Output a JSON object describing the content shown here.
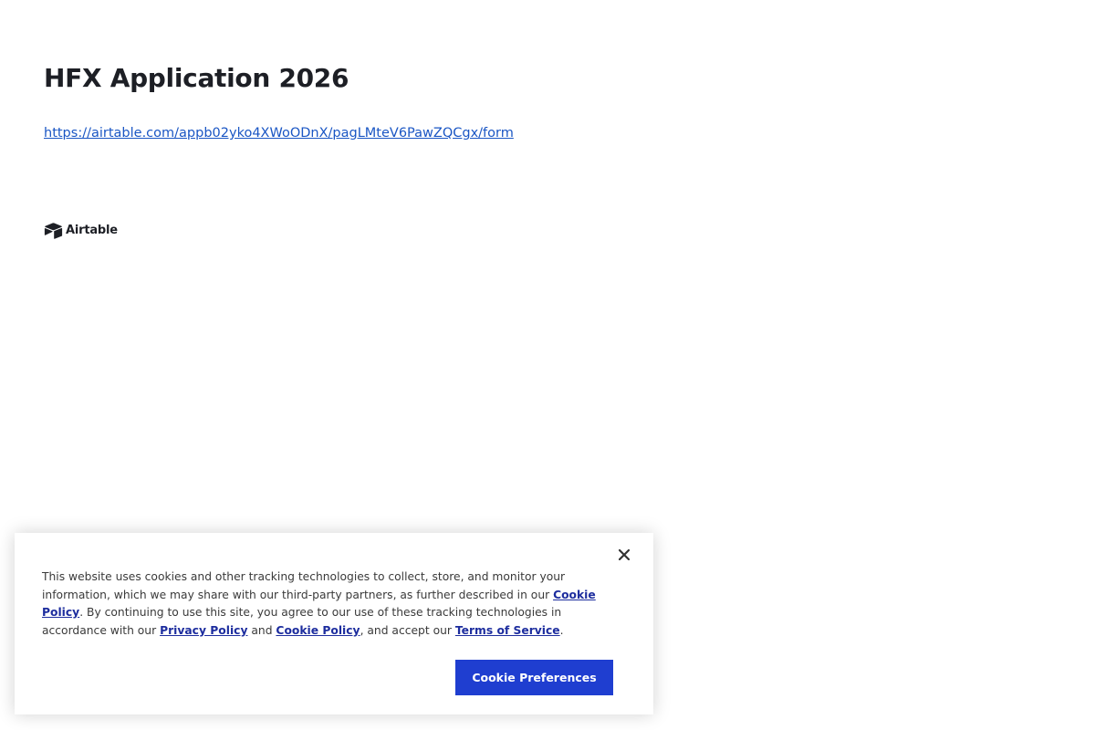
{
  "page": {
    "title": "HFX Application 2026",
    "form_link": "https://airtable.com/appb02yko4XWoODnX/pagLMteV6PawZQCgx/form"
  },
  "brand": {
    "name": "Airtable",
    "icon": "airtable-logo-icon"
  },
  "cookie_banner": {
    "text_1": "This website uses cookies and other tracking technologies to collect, store, and monitor your information, which we may share with our third-party partners, as further described in our ",
    "cookie_policy_link_1": "Cookie Policy",
    "text_2": ". By continuing to use this site, you agree to our use of these tracking technologies in accordance with our ",
    "privacy_policy_link": "Privacy Policy",
    "text_3": " and ",
    "cookie_policy_link_2": "Cookie Policy",
    "text_4": ", and accept our ",
    "terms_link": "Terms of Service",
    "text_5": ".",
    "preferences_button": "Cookie Preferences",
    "close_icon": "close-icon"
  },
  "colors": {
    "link": "#1a56c4",
    "banner_link": "#1d2d9e",
    "button_bg": "#1f3ed0",
    "title": "#1d1f25"
  }
}
